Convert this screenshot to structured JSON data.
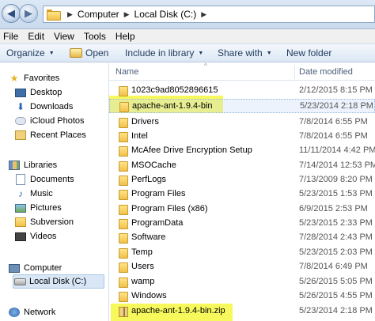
{
  "address": {
    "crumbs": [
      "Computer",
      "Local Disk (C:)"
    ]
  },
  "menu": [
    "File",
    "Edit",
    "View",
    "Tools",
    "Help"
  ],
  "toolbar": {
    "organize": "Organize",
    "open": "Open",
    "include": "Include in library",
    "share": "Share with",
    "new_folder": "New folder"
  },
  "sidebar": {
    "favorites": "Favorites",
    "fav_items": [
      "Desktop",
      "Downloads",
      "iCloud Photos",
      "Recent Places"
    ],
    "libraries": "Libraries",
    "lib_items": [
      "Documents",
      "Music",
      "Pictures",
      "Subversion",
      "Videos"
    ],
    "computer": "Computer",
    "computer_items": [
      "Local Disk (C:)"
    ],
    "network": "Network"
  },
  "columns": {
    "name": "Name",
    "date": "Date modified"
  },
  "files": [
    {
      "name": "1023c9ad8052896615",
      "date": "2/12/2015 8:15 PM",
      "type": "folder"
    },
    {
      "name": "apache-ant-1.9.4-bin",
      "date": "5/23/2014 2:18 PM",
      "type": "folder",
      "highlight": true
    },
    {
      "name": "Drivers",
      "date": "7/8/2014 6:55 PM",
      "type": "folder"
    },
    {
      "name": "Intel",
      "date": "7/8/2014 6:55 PM",
      "type": "folder"
    },
    {
      "name": "McAfee Drive Encryption Setup",
      "date": "11/11/2014 4:42 PM",
      "type": "folder"
    },
    {
      "name": "MSOCache",
      "date": "7/14/2014 12:53 PM",
      "type": "folder"
    },
    {
      "name": "PerfLogs",
      "date": "7/13/2009 8:20 PM",
      "type": "folder"
    },
    {
      "name": "Program Files",
      "date": "5/23/2015 1:53 PM",
      "type": "folder"
    },
    {
      "name": "Program Files (x86)",
      "date": "6/9/2015 2:53 PM",
      "type": "folder"
    },
    {
      "name": "ProgramData",
      "date": "5/23/2015 2:33 PM",
      "type": "folder"
    },
    {
      "name": "Software",
      "date": "7/28/2014 2:43 PM",
      "type": "folder"
    },
    {
      "name": "Temp",
      "date": "5/23/2015 2:03 PM",
      "type": "folder"
    },
    {
      "name": "Users",
      "date": "7/8/2014 6:49 PM",
      "type": "folder"
    },
    {
      "name": "wamp",
      "date": "5/26/2015 5:05 PM",
      "type": "folder"
    },
    {
      "name": "Windows",
      "date": "5/26/2015 4:55 PM",
      "type": "folder"
    },
    {
      "name": "apache-ant-1.9.4-bin.zip",
      "date": "5/23/2014 2:18 PM",
      "type": "zip",
      "highlight": true
    }
  ],
  "colors": {
    "highlight": "#f6f740",
    "toolbar_text": "#1e395b"
  }
}
